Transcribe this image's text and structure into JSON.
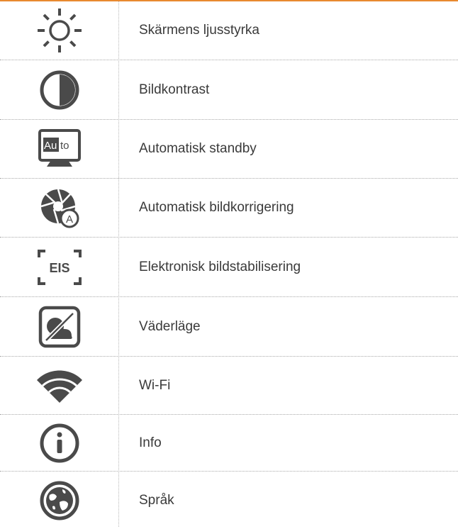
{
  "accent_color": "#e8892f",
  "icon_color": "#4a4a4a",
  "rows": [
    {
      "icon": "brightness-icon",
      "label": "Skärmens ljusstyrka"
    },
    {
      "icon": "contrast-icon",
      "label": "Bildkontrast"
    },
    {
      "icon": "auto-standby-icon",
      "icon_text": {
        "a": "Au",
        "b": "to"
      },
      "label": "Automatisk standby"
    },
    {
      "icon": "auto-correction-icon",
      "icon_text": "A",
      "label": "Automatisk bildkorrigering"
    },
    {
      "icon": "eis-icon",
      "icon_text": "EIS",
      "label": "Elektronisk bildstabilisering"
    },
    {
      "icon": "weather-mode-icon",
      "label": "Väderläge"
    },
    {
      "icon": "wifi-icon",
      "label": "Wi-Fi"
    },
    {
      "icon": "info-icon",
      "label": "Info"
    },
    {
      "icon": "language-globe-icon",
      "label": "Språk"
    }
  ]
}
